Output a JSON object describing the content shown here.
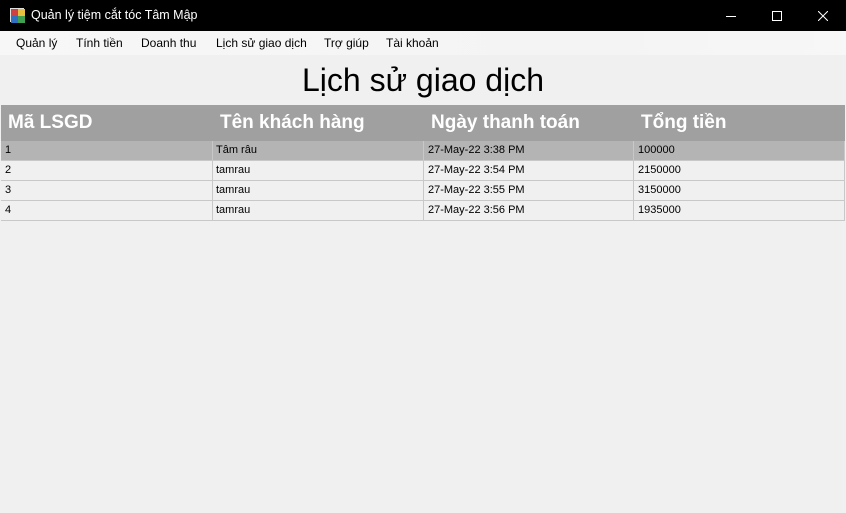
{
  "window": {
    "title": "Quản lý tiệm cắt tóc Tâm Mập"
  },
  "menu": {
    "items": [
      {
        "label": "Quản lý"
      },
      {
        "label": "Tính tiền"
      },
      {
        "label": "Doanh thu"
      },
      {
        "label": "Lịch sử giao dịch"
      },
      {
        "label": "Trợ giúp"
      },
      {
        "label": "Tài khoản"
      }
    ]
  },
  "page": {
    "title": "Lịch sử giao dịch"
  },
  "grid": {
    "columns": [
      "Mã LSGD",
      "Tên khách hàng",
      "Ngày thanh toán",
      "Tổng tiền"
    ],
    "rows": [
      {
        "id": "1",
        "customer": "Tâm râu",
        "date": "27-May-22 3:38 PM",
        "total": "100000"
      },
      {
        "id": "2",
        "customer": "tamrau",
        "date": "27-May-22 3:54 PM",
        "total": "2150000"
      },
      {
        "id": "3",
        "customer": "tamrau",
        "date": "27-May-22 3:55 PM",
        "total": "3150000"
      },
      {
        "id": "4",
        "customer": "tamrau",
        "date": "27-May-22 3:56 PM",
        "total": "1935000"
      }
    ],
    "selected_row": 1
  },
  "colors": {
    "titlebar": "#000000",
    "header": "#a0a0a0",
    "selected_row": "#b4b4b4",
    "background": "#f0f0f0"
  },
  "icons": {
    "app": "app-icon",
    "minimize": "minimize-icon",
    "maximize": "maximize-icon",
    "close": "close-icon"
  }
}
